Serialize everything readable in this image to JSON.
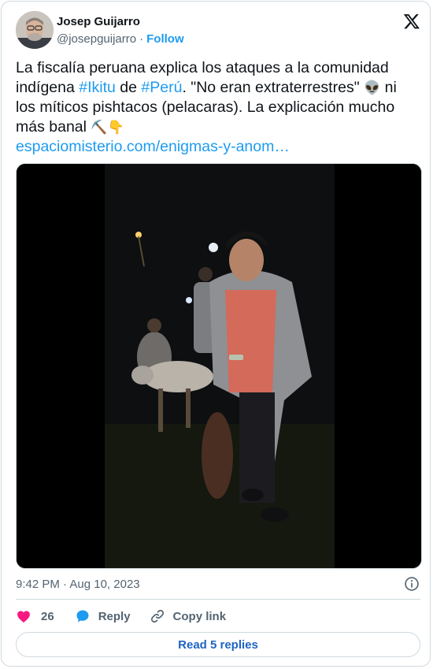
{
  "author": {
    "name": "Josep Guijarro",
    "handle": "@josepguijarro",
    "separator": "·",
    "follow_label": "Follow"
  },
  "tweet": {
    "text_part1": "La fiscalía peruana explica los ataques a la comunidad indígena ",
    "hashtag1": "#Ikitu",
    "text_part2": " de ",
    "hashtag2": "#Perú",
    "text_part3": ". \"No eran extraterrestres\" ",
    "emoji_alien": "👽",
    "text_part4": " ni los míticos pishtacos (pelacaras). La explicación mucho más banal ",
    "emoji_pick": "⛏️",
    "emoji_point": "👇",
    "link": "espaciomisterio.com/enigmas-y-anom…"
  },
  "meta": {
    "time": "9:42 PM",
    "separator": "·",
    "date": "Aug 10, 2023"
  },
  "actions": {
    "like_count": "26",
    "reply_label": "Reply",
    "copy_link_label": "Copy link"
  },
  "read_replies_label": "Read 5 replies",
  "colors": {
    "accent": "#1d9bf0",
    "like": "#f91880",
    "text": "#0f1419",
    "muted": "#536471",
    "border": "#cfd9de"
  },
  "icons": [
    "x-logo-icon",
    "info-icon",
    "heart-icon",
    "reply-bubble-icon",
    "link-icon"
  ]
}
